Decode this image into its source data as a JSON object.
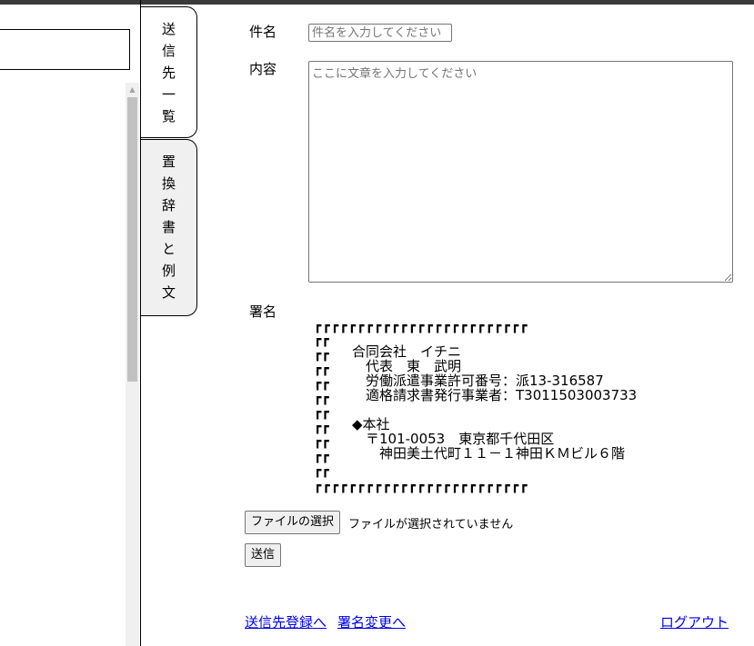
{
  "tabs": {
    "recipients_label": "送信先一覧",
    "dictionary_label": "置換辞書と例文"
  },
  "form": {
    "subject_label": "件名",
    "subject_placeholder": "件名を入力してください",
    "content_label": "内容",
    "content_placeholder": "ここに文章を入力してください",
    "signature_label": "署名"
  },
  "signature": {
    "border_top": "┏┏┏┏┏┏┏┏┏┏┏┏┏┏┏┏┏┏┏┏┏┏┏┏┏",
    "border_left": "┏┏\n┏┏\n┏┏\n┏┏\n┏┏\n┏┏\n┏┏\n┏┏\n┏┏\n┏┏",
    "border_bottom": "┏┏┏┏┏┏┏┏┏┏┏┏┏┏┏┏┏┏┏┏┏┏┏┏┏",
    "text": "合同会社　イチニ\n　代表　東　武明\n　労働派遣事業許可番号：派13-316587\n　適格請求書発行事業者：T3011503003733\n\n◆本社\n　〒101-0053　東京都千代田区\n　　神田美土代町１１－１神田ＫＭビル６階"
  },
  "file": {
    "choose_button": "ファイルの選択",
    "status": "ファイルが選択されていません"
  },
  "send_button": "送信",
  "links": {
    "register_recipients": "送信先登録へ",
    "change_signature": "署名変更へ",
    "logout": "ログアウト"
  },
  "icons": {
    "scroll_up": "scroll-up-arrow-icon"
  }
}
